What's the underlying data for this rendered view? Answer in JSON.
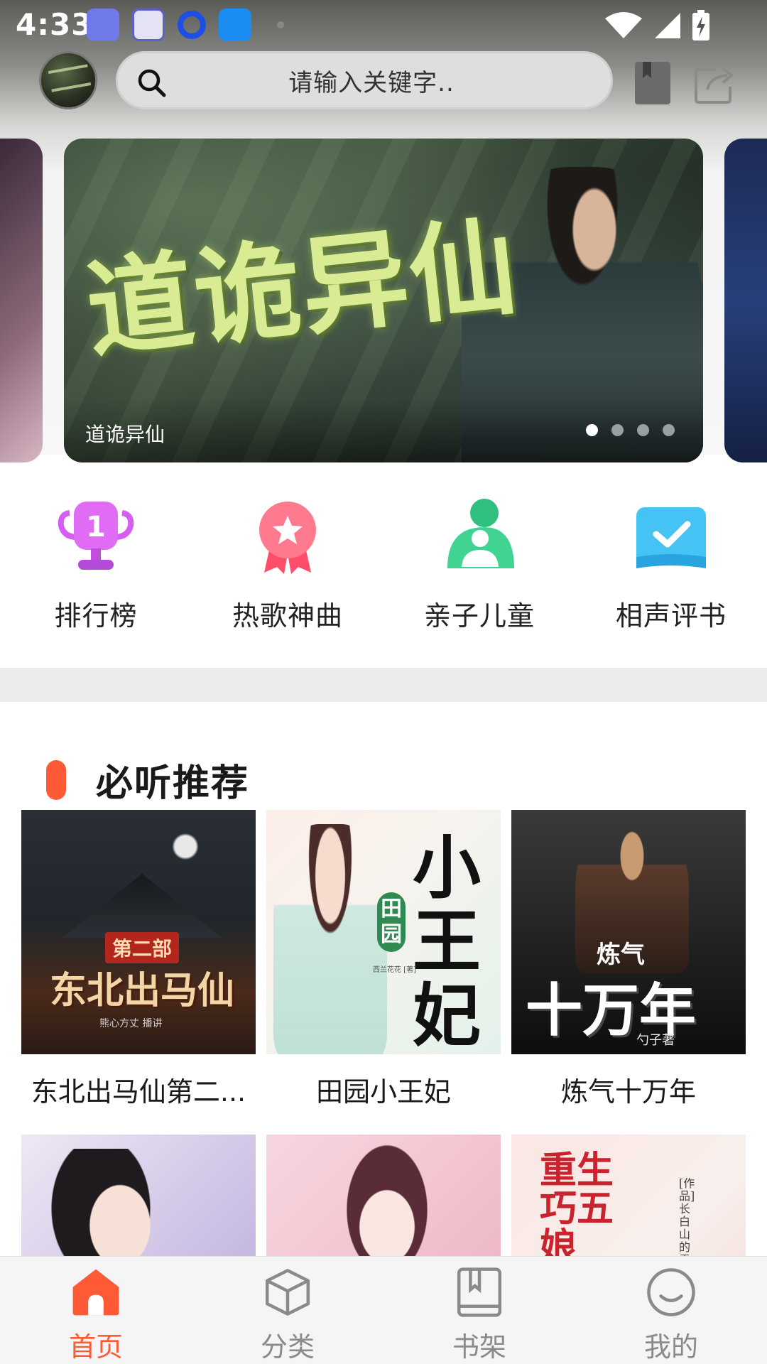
{
  "status_bar": {
    "time": "4:33",
    "app_icons": [
      "book-reader-icon",
      "headphone-icon",
      "circle-icon",
      "video-icon"
    ]
  },
  "header": {
    "search_placeholder": "请输入关键字.."
  },
  "banner": {
    "art_title": "道诡异仙",
    "caption": "道诡异仙",
    "slide_count": 4,
    "active_index": 0
  },
  "categories": [
    {
      "label": "排行榜",
      "icon": "trophy-icon",
      "color": "#d45df2"
    },
    {
      "label": "热歌神曲",
      "icon": "medal-icon",
      "color": "#ff5c7a"
    },
    {
      "label": "亲子儿童",
      "icon": "parent-child-icon",
      "color": "#3ccf8f"
    },
    {
      "label": "相声评书",
      "icon": "checkbook-icon",
      "color": "#3db6f2"
    }
  ],
  "recommend": {
    "title": "必听推荐",
    "books": [
      {
        "title": "东北出马仙第二...",
        "cover_series": "第二部",
        "cover_text": "东北出马仙",
        "cover_credit": "熊心方丈 播讲"
      },
      {
        "title": "田园小王妃",
        "cover_text": "小王妃",
        "cover_badge": "田园",
        "cover_credit": "西兰花花 [著]"
      },
      {
        "title": "炼气十万年",
        "cover_top": "炼气",
        "cover_text": "十万年",
        "cover_credit": "勺子著"
      },
      {
        "title": "",
        "cover_text": ""
      },
      {
        "title": "",
        "cover_text": ""
      },
      {
        "title": "",
        "cover_text": "重生巧五娘",
        "cover_credit": "[作品] 长白山的雪"
      }
    ]
  },
  "bottom_nav": {
    "active": "首页",
    "items": [
      {
        "label": "首页",
        "icon": "home-icon"
      },
      {
        "label": "分类",
        "icon": "cube-icon"
      },
      {
        "label": "书架",
        "icon": "bookshelf-icon"
      },
      {
        "label": "我的",
        "icon": "smile-icon"
      }
    ]
  },
  "colors": {
    "accent": "#ff5a36",
    "nav_inactive": "#8a8a8a"
  }
}
